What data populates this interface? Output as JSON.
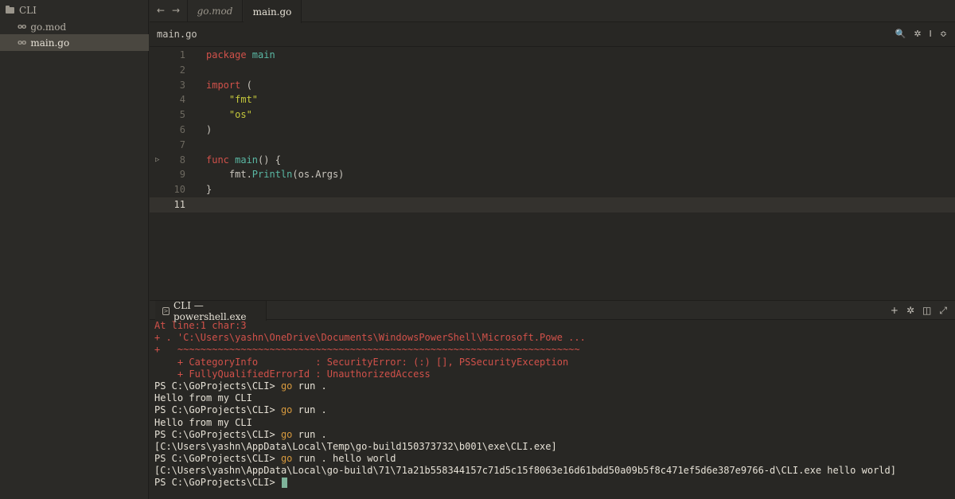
{
  "sidebar": {
    "root_label": "CLI",
    "files": [
      {
        "label": "go.mod"
      },
      {
        "label": "main.go"
      }
    ]
  },
  "tabs": [
    {
      "label": "go.mod"
    },
    {
      "label": "main.go"
    }
  ],
  "nav": {
    "back": "←",
    "forward": "→"
  },
  "breadcrumb": {
    "path": "main.go"
  },
  "breadcrumb_tools": [
    "🔍",
    "✲",
    "I",
    "≎"
  ],
  "editor": {
    "lines": [
      {
        "n": "1",
        "tokens": [
          {
            "t": "package ",
            "c": "kw"
          },
          {
            "t": "main",
            "c": "call"
          }
        ]
      },
      {
        "n": "2",
        "tokens": []
      },
      {
        "n": "3",
        "tokens": [
          {
            "t": "import ",
            "c": "kw"
          },
          {
            "t": "(",
            "c": "fn"
          }
        ]
      },
      {
        "n": "4",
        "tokens": [
          {
            "t": "    ",
            "c": "fn"
          },
          {
            "t": "\"fmt\"",
            "c": "str"
          }
        ]
      },
      {
        "n": "5",
        "tokens": [
          {
            "t": "    ",
            "c": "fn"
          },
          {
            "t": "\"os\"",
            "c": "str"
          }
        ]
      },
      {
        "n": "6",
        "tokens": [
          {
            "t": ")",
            "c": "fn"
          }
        ]
      },
      {
        "n": "7",
        "tokens": []
      },
      {
        "n": "8",
        "tokens": [
          {
            "t": "func ",
            "c": "kw"
          },
          {
            "t": "main",
            "c": "call"
          },
          {
            "t": "() {",
            "c": "fn"
          }
        ]
      },
      {
        "n": "9",
        "tokens": [
          {
            "t": "    fmt.",
            "c": "fn"
          },
          {
            "t": "Println",
            "c": "call"
          },
          {
            "t": "(os.Args)",
            "c": "fn"
          }
        ]
      },
      {
        "n": "10",
        "tokens": [
          {
            "t": "}",
            "c": "fn"
          }
        ]
      },
      {
        "n": "11",
        "tokens": []
      }
    ],
    "active_line": 11,
    "run_marker_line": 8
  },
  "terminal_tab": {
    "label": "CLI — powershell.exe"
  },
  "panel_tools": [
    "+",
    "✲",
    "◫",
    "⤢"
  ],
  "terminal": {
    "lines": [
      {
        "text": "At line:1 char:3",
        "c": "err"
      },
      {
        "text": "+ . 'C:\\Users\\yashn\\OneDrive\\Documents\\WindowsPowerShell\\Microsoft.Powe ...",
        "c": "err"
      },
      {
        "text": "+   ~~~~~~~~~~~~~~~~~~~~~~~~~~~~~~~~~~~~~~~~~~~~~~~~~~~~~~~~~~~~~~~~~~~~~~",
        "c": "err"
      },
      {
        "text": "    + CategoryInfo          : SecurityError: (:) [], PSSecurityException",
        "c": "err"
      },
      {
        "text": "    + FullyQualifiedErrorId : UnauthorizedAccess",
        "c": "err"
      },
      {
        "prompt": "PS C:\\GoProjects\\CLI> ",
        "cmd": "go",
        "rest": " run ."
      },
      {
        "text": "Hello from my CLI",
        "c": ""
      },
      {
        "prompt": "PS C:\\GoProjects\\CLI> ",
        "cmd": "go",
        "rest": " run ."
      },
      {
        "text": "Hello from my CLI",
        "c": ""
      },
      {
        "prompt": "PS C:\\GoProjects\\CLI> ",
        "cmd": "go",
        "rest": " run ."
      },
      {
        "text": "[C:\\Users\\yashn\\AppData\\Local\\Temp\\go-build150373732\\b001\\exe\\CLI.exe]",
        "c": ""
      },
      {
        "prompt": "PS C:\\GoProjects\\CLI> ",
        "cmd": "go",
        "rest": " run . hello world"
      },
      {
        "text": "[C:\\Users\\yashn\\AppData\\Local\\go-build\\71\\71a21b558344157c71d5c15f8063e16d61bdd50a09b5f8c471ef5d6e387e9766-d\\CLI.exe hello world]",
        "c": ""
      },
      {
        "prompt": "PS C:\\GoProjects\\CLI> ",
        "cmd": "",
        "rest": "",
        "cursor": true
      }
    ]
  }
}
